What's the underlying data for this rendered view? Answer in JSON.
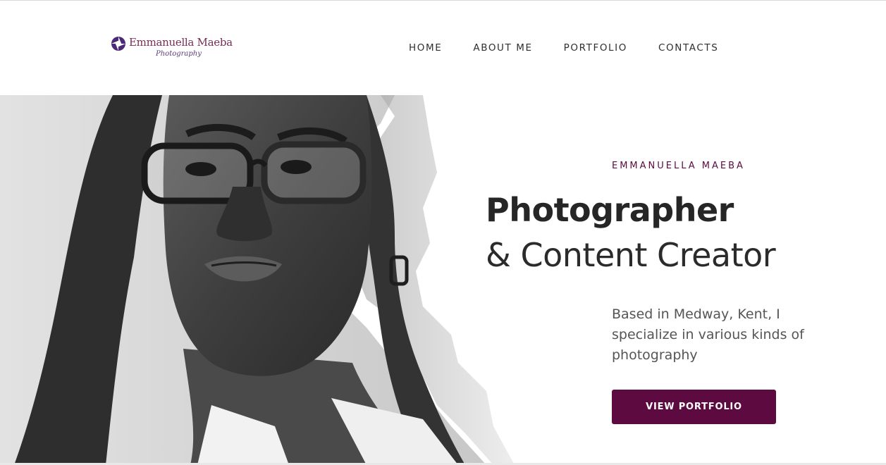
{
  "header": {
    "logo": {
      "name": "Emmanuella Maeba",
      "subtitle": "Photography",
      "icon": "aperture-icon"
    },
    "nav": [
      {
        "label": "HOME"
      },
      {
        "label": "ABOUT ME"
      },
      {
        "label": "PORTFOLIO"
      },
      {
        "label": "CONTACTS"
      }
    ]
  },
  "hero": {
    "eyebrow": "EMMANUELLA MAEBA",
    "title_bold": "Photographer",
    "title_light": "& Content Creator",
    "description": "Based in Medway, Kent, I specialize in various kinds of photography",
    "cta_label": "VIEW PORTFOLIO",
    "image": "portrait-photo"
  },
  "colors": {
    "accent": "#5c0a40",
    "logo_text": "#7a2d55",
    "logo_mark": "#4b2a7a",
    "text_dark": "#262626"
  }
}
